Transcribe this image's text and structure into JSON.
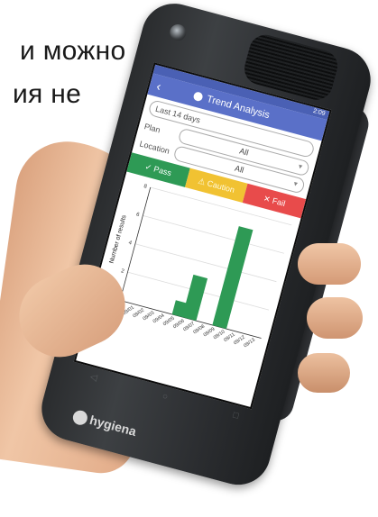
{
  "background_text": {
    "line1": "и можно",
    "line2": "ия не"
  },
  "device": {
    "statusbar": {
      "time": "2:09"
    },
    "appbar": {
      "back_icon": "back-arrow-icon",
      "title_icon": "clock-icon",
      "title": "Trend Analysis"
    },
    "filters": {
      "date_range": "Last 14 days",
      "plan_label": "Plan",
      "plan_value": "All",
      "location_label": "Location",
      "location_value": "All"
    },
    "status_buttons": {
      "pass": "✓ Pass",
      "caution": "⚠ Caution",
      "fail": "✕ Fail"
    },
    "logo_text": "hygiena"
  },
  "chart_data": {
    "type": "bar",
    "ylabel": "Number of results",
    "ylim": [
      0,
      8
    ],
    "yticks": [
      "0",
      "2",
      "4",
      "6",
      "8"
    ],
    "categories": [
      "08/31",
      "09/01",
      "09/02",
      "09/03",
      "09/04",
      "09/05",
      "09/06",
      "09/07",
      "09/08",
      "09/09",
      "09/10",
      "09/11",
      "09/12",
      "09/13"
    ],
    "series": [
      {
        "values": [
          0,
          0,
          0,
          0,
          0,
          1,
          3,
          0,
          0,
          7,
          0,
          0,
          0,
          0
        ],
        "color": "#2e9a55"
      }
    ]
  }
}
